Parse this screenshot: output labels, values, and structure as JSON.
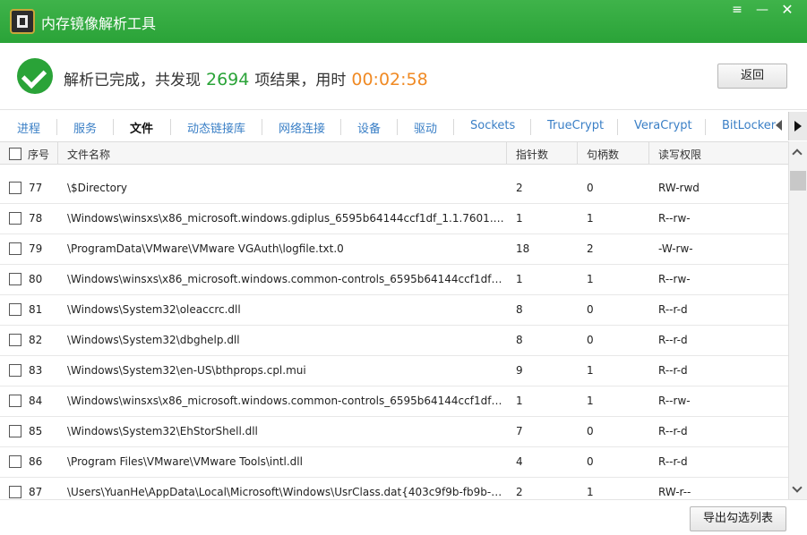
{
  "window": {
    "title": "内存镜像解析工具",
    "menu_icon": "≡",
    "minimize_icon": "—",
    "close_icon": "✕"
  },
  "status": {
    "prefix": "解析已完成，共发现",
    "count": "2694",
    "middle": "项结果，用时",
    "time": "00:02:58",
    "back_label": "返回"
  },
  "tabs": [
    "进程",
    "服务",
    "文件",
    "动态链接库",
    "网络连接",
    "设备",
    "驱动",
    "Sockets",
    "TrueCrypt",
    "VeraCrypt",
    "BitLocker"
  ],
  "active_tab": "文件",
  "table": {
    "headers": {
      "no": "序号",
      "name": "文件名称",
      "pointers": "指针数",
      "handles": "句柄数",
      "perms": "读写权限"
    },
    "rows": [
      {
        "no": "77",
        "name": "\\$Directory",
        "pointers": "2",
        "handles": "0",
        "perms": "RW-rwd"
      },
      {
        "no": "78",
        "name": "\\Windows\\winsxs\\x86_microsoft.windows.gdiplus_6595b64144ccf1df_1.1.7601.175...",
        "pointers": "1",
        "handles": "1",
        "perms": "R--rw-"
      },
      {
        "no": "79",
        "name": "\\ProgramData\\VMware\\VMware VGAuth\\logfile.txt.0",
        "pointers": "18",
        "handles": "2",
        "perms": "-W-rw-"
      },
      {
        "no": "80",
        "name": "\\Windows\\winsxs\\x86_microsoft.windows.common-controls_6595b64144ccf1df_5....",
        "pointers": "1",
        "handles": "1",
        "perms": "R--rw-"
      },
      {
        "no": "81",
        "name": "\\Windows\\System32\\oleaccrc.dll",
        "pointers": "8",
        "handles": "0",
        "perms": "R--r-d"
      },
      {
        "no": "82",
        "name": "\\Windows\\System32\\dbghelp.dll",
        "pointers": "8",
        "handles": "0",
        "perms": "R--r-d"
      },
      {
        "no": "83",
        "name": "\\Windows\\System32\\en-US\\bthprops.cpl.mui",
        "pointers": "9",
        "handles": "1",
        "perms": "R--r-d"
      },
      {
        "no": "84",
        "name": "\\Windows\\winsxs\\x86_microsoft.windows.common-controls_6595b64144ccf1df_6....",
        "pointers": "1",
        "handles": "1",
        "perms": "R--rw-"
      },
      {
        "no": "85",
        "name": "\\Windows\\System32\\EhStorShell.dll",
        "pointers": "7",
        "handles": "0",
        "perms": "R--r-d"
      },
      {
        "no": "86",
        "name": "\\Program Files\\VMware\\VMware Tools\\intl.dll",
        "pointers": "4",
        "handles": "0",
        "perms": "R--r-d"
      },
      {
        "no": "87",
        "name": "\\Users\\YuanHe\\AppData\\Local\\Microsoft\\Windows\\UsrClass.dat{403c9f9b-fb9b-1...",
        "pointers": "2",
        "handles": "1",
        "perms": "RW-r--"
      }
    ]
  },
  "footer": {
    "export_label": "导出勾选列表"
  },
  "colors": {
    "brand_green": "#2aa338",
    "time_orange": "#f08a24",
    "tab_blue": "#3a7fc6"
  }
}
